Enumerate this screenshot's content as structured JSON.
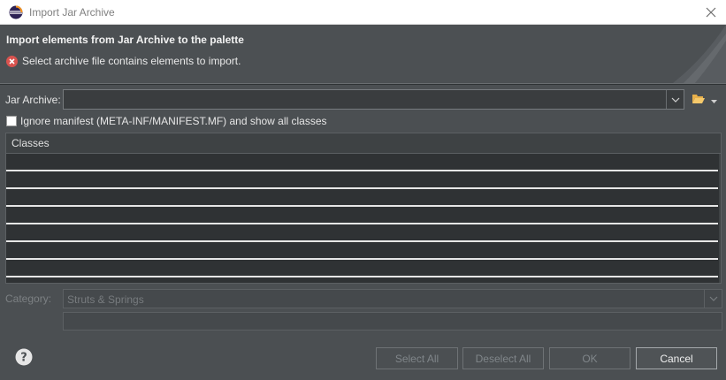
{
  "window": {
    "title": "Import Jar Archive"
  },
  "banner": {
    "heading": "Import elements from Jar Archive to the palette",
    "message": "Select archive file contains elements to import."
  },
  "form": {
    "jar_archive_label": "Jar Archive:",
    "jar_archive_value": "",
    "ignore_manifest_label": "Ignore manifest (META-INF/MANIFEST.MF) and show all classes",
    "ignore_manifest_checked": false,
    "category_label": "Category:",
    "category_value": "Struts & Springs",
    "description_value": ""
  },
  "classes_table": {
    "header": "Classes",
    "rows": [
      "",
      "",
      "",
      "",
      "",
      "",
      ""
    ]
  },
  "buttons": {
    "select_all": "Select All",
    "deselect_all": "Deselect All",
    "ok": "OK",
    "cancel": "Cancel"
  },
  "colors": {
    "background": "#4b4f52",
    "error": "#d9534f",
    "table_bg": "#2f3234"
  }
}
